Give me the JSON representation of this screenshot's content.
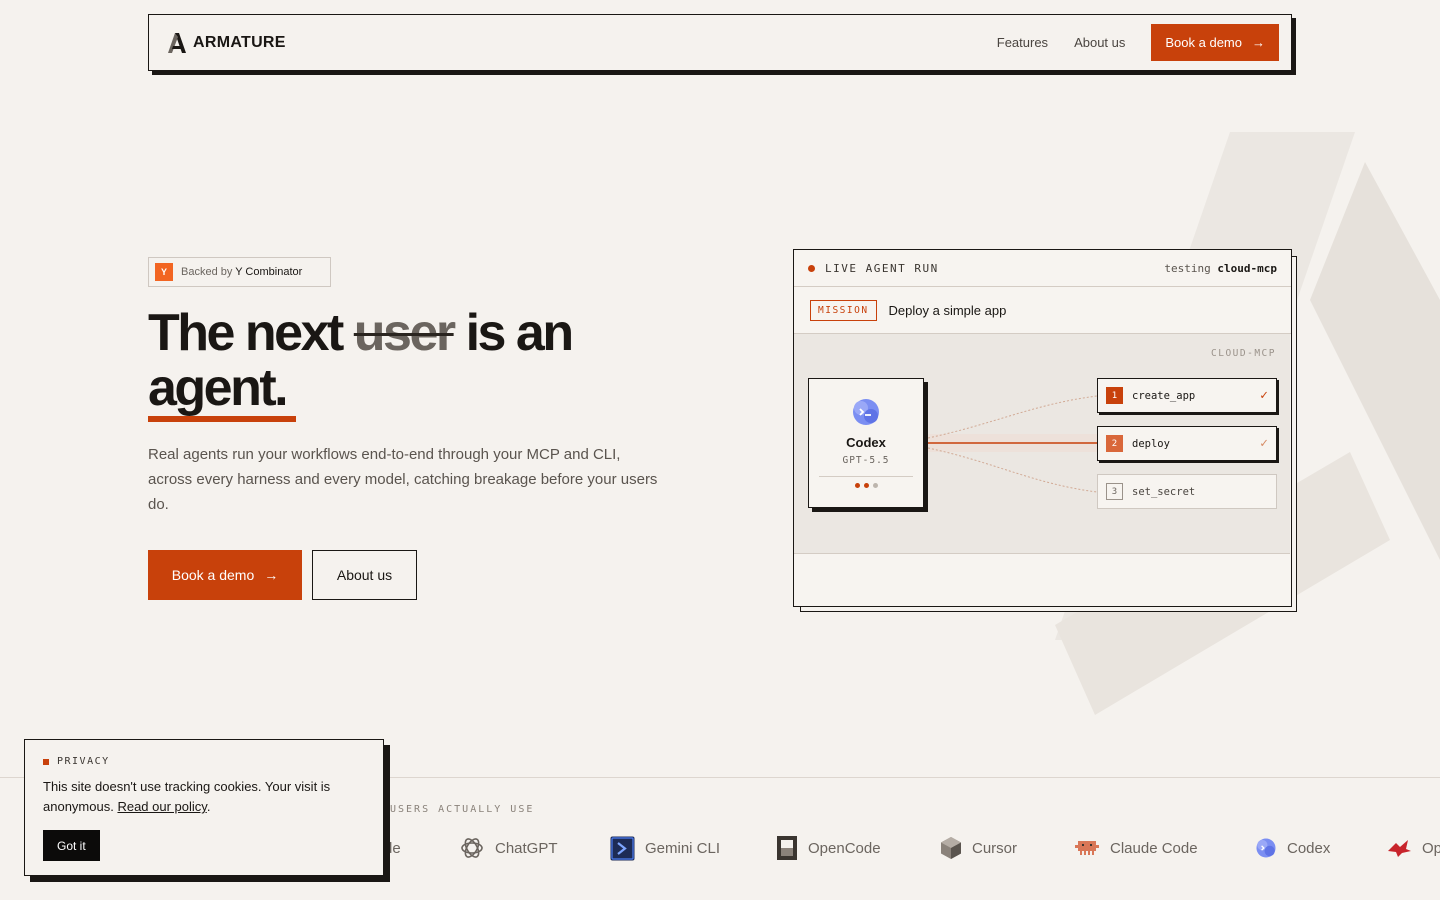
{
  "nav": {
    "brand": "ARMATURE",
    "links": [
      "Features",
      "About us"
    ],
    "cta": "Book a demo",
    "arrow": "→"
  },
  "hero": {
    "badge_prefix": "Backed by",
    "badge_strong": "Y Combinator",
    "badge_logo": "Y",
    "headline_1": "The next",
    "headline_strike": "user",
    "headline_2": "is an",
    "headline_3": "agent.",
    "subtext": "Real agents run your workflows end-to-end through your MCP and CLI, across every harness and every model, catching breakage before your users do.",
    "cta_primary": "Book a demo",
    "cta_secondary": "About us"
  },
  "panel": {
    "live_label": "LIVE AGENT RUN",
    "testing_prefix": "testing",
    "testing_target": "cloud-mcp",
    "mission_tag": "MISSION",
    "mission_text": "Deploy a simple app",
    "canvas_label": "CLOUD-MCP",
    "agent_name": "Codex",
    "agent_model": "GPT-5.5",
    "steps": [
      {
        "num": "1",
        "label": "create_app",
        "check": "✓"
      },
      {
        "num": "2",
        "label": "deploy",
        "check": "✓"
      },
      {
        "num": "3",
        "label": "set_secret",
        "check": ""
      }
    ]
  },
  "logos": {
    "label": "USERS ACTUALLY USE",
    "items": [
      "de",
      "ChatGPT",
      "Gemini CLI",
      "OpenCode",
      "Cursor",
      "Claude Code",
      "Codex",
      "Op"
    ]
  },
  "privacy": {
    "tag": "PRIVACY",
    "text": "This site doesn't use tracking cookies. Your visit is anonymous.",
    "link": "Read our policy",
    "after_link": ".",
    "button": "Got it"
  },
  "colors": {
    "accent": "#c8410b",
    "background": "#f5f2ee",
    "ink": "#1a1714"
  }
}
